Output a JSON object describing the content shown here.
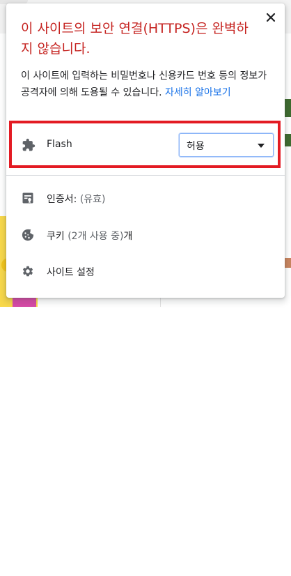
{
  "popup": {
    "title": "이 사이트의 보안 연결(HTTPS)은 완벽하지 않습니다.",
    "description": "이 사이트에 입력하는 비밀번호나 신용카드 번호 등의 정보가 공격자에 의해 도용될 수 있습니다.",
    "learn_more": "자세히 알아보기",
    "close_icon": "close-icon"
  },
  "permissions": [
    {
      "icon": "puzzle-icon",
      "label": "Flash",
      "selected": "허용",
      "highlighted": true,
      "highlight_color": "#e31b23"
    }
  ],
  "menu": {
    "certificate": {
      "icon": "certificate-icon",
      "label": "인증서:",
      "status": "(유효)"
    },
    "cookies": {
      "icon": "cookie-icon",
      "label": "쿠키",
      "status": "(2개 사용 중)",
      "suffix": "개"
    },
    "site_settings": {
      "icon": "gear-icon",
      "label": "사이트 설정"
    }
  },
  "colors": {
    "warning_title": "#c5221f",
    "link": "#1a73e8",
    "text": "#202124",
    "icon": "#5f6368"
  }
}
